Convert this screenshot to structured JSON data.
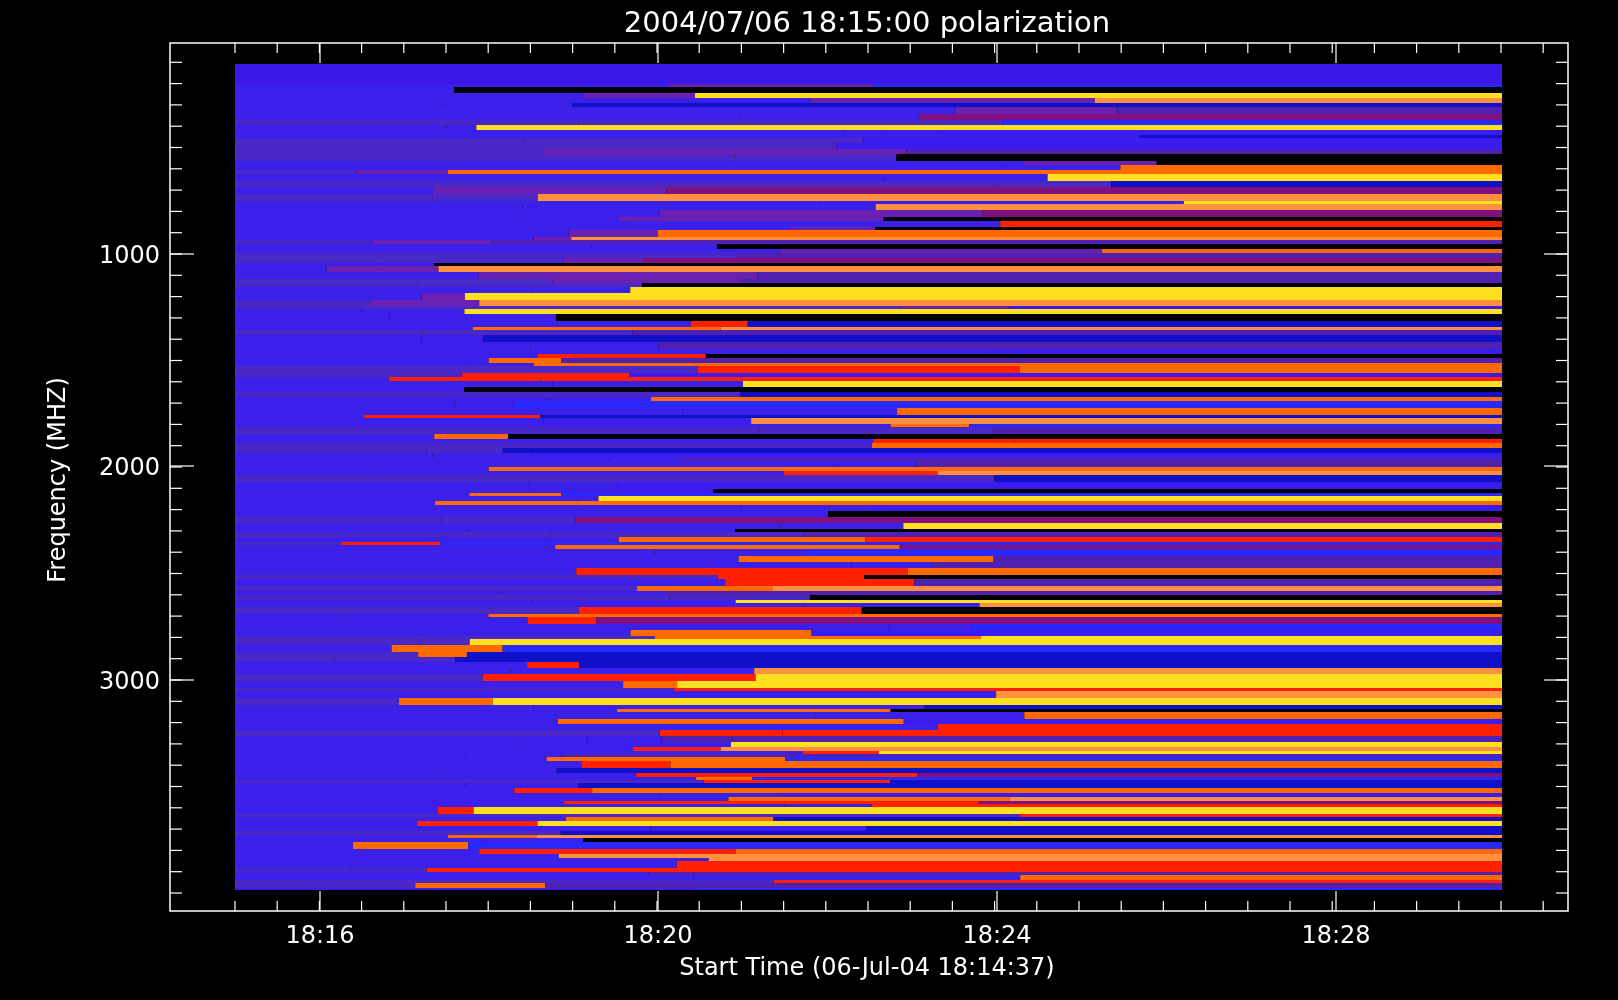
{
  "title": "2004/07/06 18:15:00 polarization",
  "y_axis": {
    "label": "Frequency (MHZ)",
    "ticks": [
      "1000",
      "2000",
      "3000"
    ]
  },
  "x_axis": {
    "label": "Start Time (06-Jul-04 18:14:37)",
    "ticks": [
      "18:16",
      "18:20",
      "18:24",
      "18:28"
    ]
  }
}
